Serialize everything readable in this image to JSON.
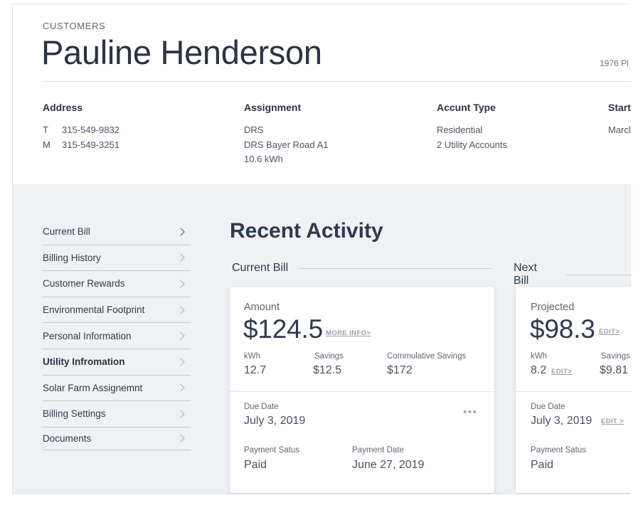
{
  "header": {
    "breadcrumb": "CUSTOMERS",
    "name": "Pauline Henderson",
    "right_text": "1976 Pl"
  },
  "info": {
    "address": {
      "title": "Address",
      "lines": [
        {
          "prefix": "T",
          "value": "315-549-9832"
        },
        {
          "prefix": "M",
          "value": "315-549-3251"
        }
      ]
    },
    "assignment": {
      "title": "Assignment",
      "lines": [
        "DRS",
        "DRS Bayer Road A1",
        "10.6 kWh"
      ]
    },
    "account_type": {
      "title": "Accunt Type",
      "lines": [
        "Residential",
        "2 Utility Accounts"
      ]
    },
    "start": {
      "title": "Start",
      "lines": [
        "Marcl"
      ]
    }
  },
  "sidebar": {
    "items": [
      {
        "label": "Current Bill"
      },
      {
        "label": "Billing History"
      },
      {
        "label": "Customer Rewards"
      },
      {
        "label": "Environmental Footprint"
      },
      {
        "label": "Personal Information"
      },
      {
        "label": "Utility Infromation"
      },
      {
        "label": "Solar Farm Assignemnt"
      },
      {
        "label": "Billing Settings"
      },
      {
        "label": "Documents"
      }
    ],
    "active_index": 5
  },
  "main": {
    "title": "Recent Activity",
    "current_bill": {
      "heading": "Current Bill",
      "amount_label": "Amount",
      "amount": "$124.5",
      "more_info": "MORE INFO>",
      "kwh_label": "kWh",
      "kwh": "12.7",
      "savings_label": "Savings",
      "savings": "$12.5",
      "cumulative_label": "Commulative Savings",
      "cumulative": "$172",
      "due_label": "Due Date",
      "due": "July 3, 2019",
      "menu": "•••",
      "status_label": "Payment Satus",
      "status": "Paid",
      "payment_date_label": "Payment Date",
      "payment_date": "June 27, 2019"
    },
    "next_bill": {
      "heading": "Next Bill",
      "amount_label": "Projected",
      "amount": "$98.3",
      "edit_amount": "EDIT>",
      "kwh_label": "kWh",
      "kwh": "8.2",
      "edit_kwh": "EDIT>",
      "savings_label": "Savings",
      "savings": "$9.81",
      "due_label": "Due Date",
      "due": "July 3, 2019",
      "edit_due": "EDIT >",
      "status_label": "Payment Satus",
      "status": "Paid"
    }
  }
}
